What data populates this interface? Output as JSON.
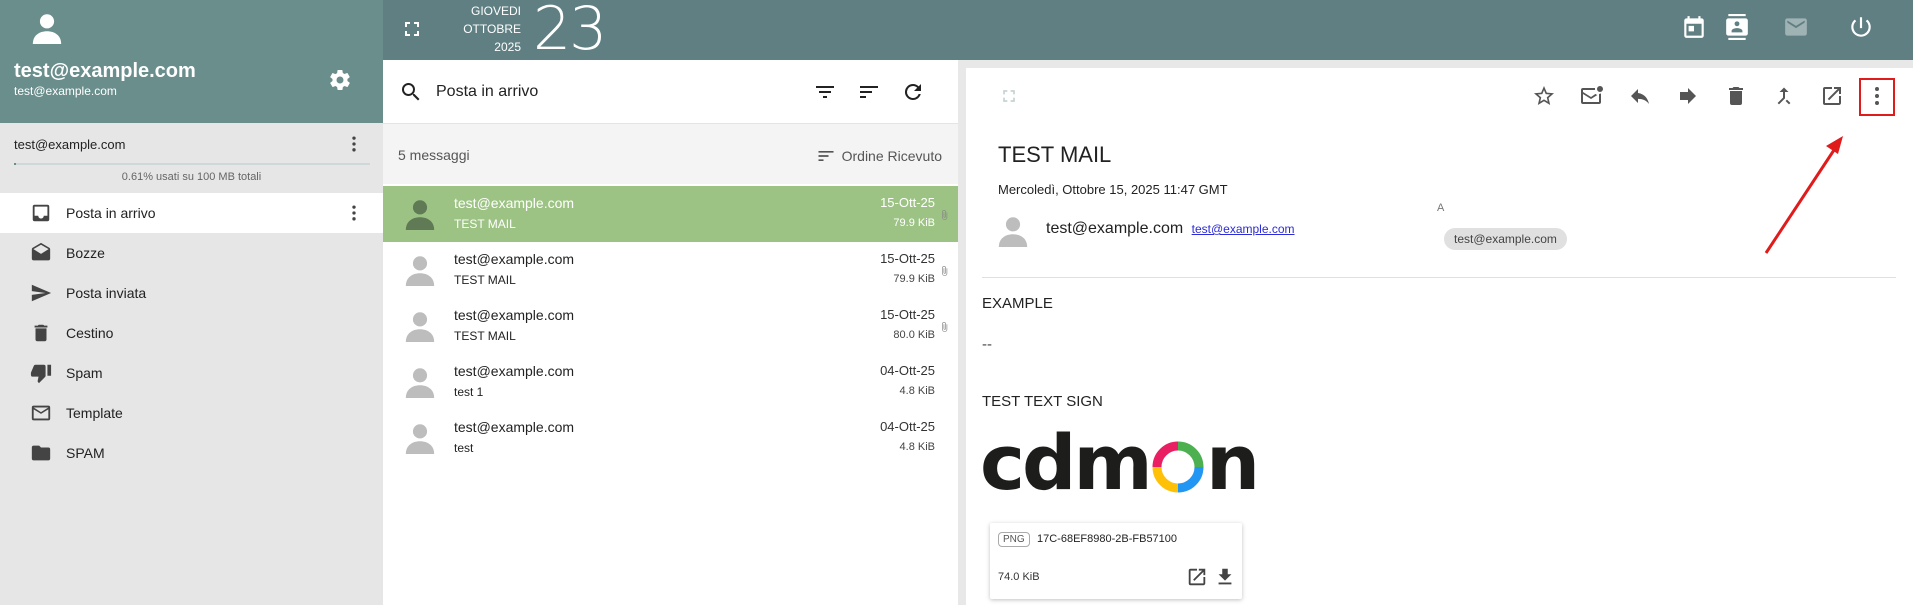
{
  "colors": {
    "header": "#6a8e8c",
    "topbar": "#5f7f82",
    "selected_row": "#9cc384",
    "highlight": "#e01b1b"
  },
  "account": {
    "display_name": "test@example.com",
    "email": "test@example.com",
    "quota_account": "test@example.com",
    "quota_text": "0.61% usati su 100 MB totali",
    "quota_fraction": 0.0061
  },
  "folders": [
    {
      "label": "Posta in arrivo",
      "icon": "inbox-icon",
      "active": true
    },
    {
      "label": "Bozze",
      "icon": "drafts-icon",
      "active": false
    },
    {
      "label": "Posta inviata",
      "icon": "send-icon",
      "active": false
    },
    {
      "label": "Cestino",
      "icon": "trash-icon",
      "active": false
    },
    {
      "label": "Spam",
      "icon": "thumb-down-icon",
      "active": false
    },
    {
      "label": "Template",
      "icon": "mail-outline-icon",
      "active": false
    },
    {
      "label": "SPAM",
      "icon": "folder-icon",
      "active": false
    }
  ],
  "topbar": {
    "weekday": "GIOVEDI",
    "month": "OTTOBRE",
    "year": "2025",
    "day": "23",
    "icons": [
      "calendar-icon",
      "contacts-icon",
      "mail-icon",
      "power-icon"
    ]
  },
  "list": {
    "folder_title": "Posta in arrivo",
    "count_text": "5 messaggi",
    "sort_label": "Ordine Ricevuto",
    "messages": [
      {
        "from": "test@example.com",
        "subject": "TEST MAIL",
        "date": "15-Ott-25",
        "size": "79.9 KiB",
        "attachment": true,
        "selected": true
      },
      {
        "from": "test@example.com",
        "subject": "TEST MAIL",
        "date": "15-Ott-25",
        "size": "79.9 KiB",
        "attachment": true,
        "selected": false
      },
      {
        "from": "test@example.com",
        "subject": "TEST MAIL",
        "date": "15-Ott-25",
        "size": "80.0 KiB",
        "attachment": true,
        "selected": false
      },
      {
        "from": "test@example.com",
        "subject": "test 1",
        "date": "04-Ott-25",
        "size": "4.8 KiB",
        "attachment": false,
        "selected": false
      },
      {
        "from": "test@example.com",
        "subject": "test",
        "date": "04-Ott-25",
        "size": "4.8 KiB",
        "attachment": false,
        "selected": false
      }
    ]
  },
  "reader": {
    "subject": "TEST MAIL",
    "date": "Mercoledì, Ottobre 15, 2025 11:47 GMT",
    "from_name": "test@example.com",
    "from_email": "test@example.com",
    "to_label": "A",
    "to_chip": "test@example.com",
    "body_line1": "EXAMPLE",
    "body_line2": "--",
    "body_line3": "TEST TEXT SIGN",
    "logo_text": "cdmon",
    "attachment": {
      "type": "PNG",
      "name": "17C-68EF8980-2B-FB57100",
      "size": "74.0 KiB"
    },
    "actions": [
      "star-icon",
      "mark-unread-icon",
      "reply-icon",
      "forward-icon",
      "delete-icon",
      "move-icon",
      "open-new-icon",
      "more-icon"
    ]
  }
}
